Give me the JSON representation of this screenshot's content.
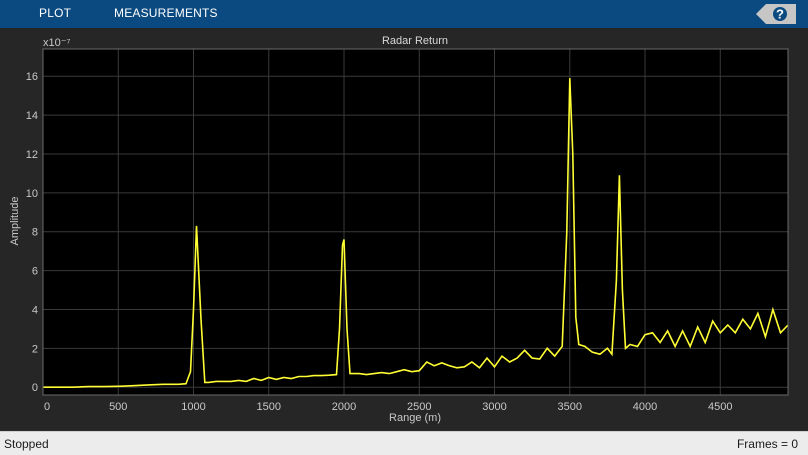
{
  "toolstrip": {
    "tabs": [
      {
        "label": "PLOT"
      },
      {
        "label": "MEASUREMENTS"
      }
    ],
    "help_symbol": "?"
  },
  "chart_data": {
    "type": "line",
    "title": "Radar Return",
    "xlabel": "Range (m)",
    "ylabel": "Amplitude",
    "exponent_label": "x10⁻⁷",
    "xlim": [
      0,
      4950
    ],
    "ylim": [
      -0.4,
      17.4
    ],
    "xticks": [
      0,
      500,
      1000,
      1500,
      2000,
      2500,
      3000,
      3500,
      4000,
      4500
    ],
    "yticks": [
      0,
      2,
      4,
      6,
      8,
      10,
      12,
      14,
      16
    ],
    "grid": true,
    "line_color": "#ffff33",
    "background_color": "#000000",
    "series": [
      {
        "x": [
          0,
          100,
          200,
          300,
          400,
          500,
          600,
          700,
          800,
          900,
          950,
          980,
          1000,
          1020,
          1050,
          1075,
          1100,
          1150,
          1200,
          1250,
          1300,
          1350,
          1400,
          1450,
          1500,
          1550,
          1600,
          1650,
          1700,
          1750,
          1800,
          1850,
          1900,
          1950,
          1970,
          1990,
          2000,
          2020,
          2040,
          2060,
          2100,
          2150,
          2200,
          2250,
          2300,
          2350,
          2400,
          2450,
          2500,
          2550,
          2600,
          2650,
          2700,
          2750,
          2800,
          2850,
          2900,
          2950,
          3000,
          3050,
          3100,
          3150,
          3200,
          3250,
          3300,
          3350,
          3400,
          3450,
          3480,
          3500,
          3520,
          3540,
          3560,
          3600,
          3650,
          3700,
          3750,
          3780,
          3810,
          3830,
          3850,
          3870,
          3900,
          3950,
          4000,
          4050,
          4100,
          4150,
          4200,
          4250,
          4300,
          4350,
          4400,
          4450,
          4500,
          4550,
          4600,
          4650,
          4700,
          4750,
          4800,
          4850,
          4900,
          4950
        ],
        "y": [
          0.0,
          0.0,
          0.0,
          0.03,
          0.03,
          0.05,
          0.08,
          0.12,
          0.15,
          0.15,
          0.18,
          0.8,
          4.0,
          8.3,
          3.5,
          0.25,
          0.25,
          0.3,
          0.3,
          0.3,
          0.35,
          0.3,
          0.45,
          0.35,
          0.5,
          0.4,
          0.5,
          0.45,
          0.55,
          0.55,
          0.6,
          0.6,
          0.62,
          0.65,
          3.0,
          7.3,
          7.6,
          3.0,
          0.7,
          0.7,
          0.7,
          0.65,
          0.7,
          0.75,
          0.7,
          0.8,
          0.9,
          0.8,
          0.85,
          1.3,
          1.1,
          1.25,
          1.1,
          1.0,
          1.05,
          1.3,
          1.0,
          1.5,
          1.05,
          1.6,
          1.3,
          1.5,
          1.9,
          1.5,
          1.45,
          2.0,
          1.6,
          2.1,
          8.0,
          15.9,
          12.0,
          3.6,
          2.2,
          2.1,
          1.8,
          1.7,
          2.0,
          1.7,
          5.5,
          10.9,
          5.0,
          2.0,
          2.2,
          2.1,
          2.7,
          2.8,
          2.3,
          2.9,
          2.1,
          2.9,
          2.1,
          3.1,
          2.3,
          3.4,
          2.8,
          3.2,
          2.8,
          3.5,
          3.0,
          3.8,
          2.6,
          4.0,
          2.8,
          3.2
        ]
      }
    ]
  },
  "status": {
    "left": "Stopped",
    "right": "Frames = 0"
  }
}
